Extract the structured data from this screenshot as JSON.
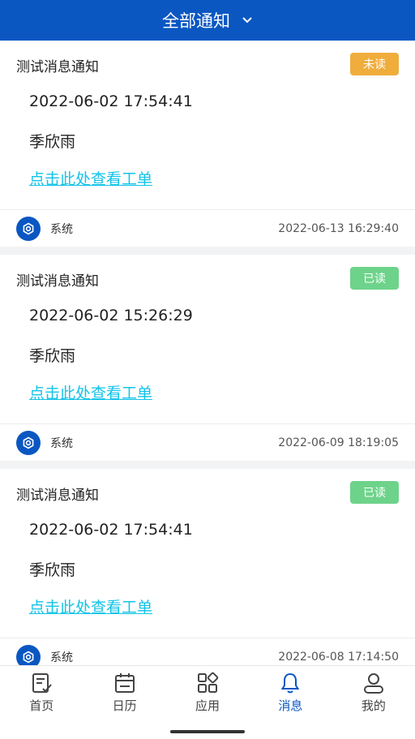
{
  "header": {
    "title": "全部通知"
  },
  "colors": {
    "brand": "#0a57c2",
    "unread": "#f0ad3c",
    "read": "#6dd38a",
    "link": "#12c3e8"
  },
  "notifications": [
    {
      "title": "测试消息通知",
      "status": "未读",
      "status_kind": "unread",
      "date": "2022-06-02 17:54:41",
      "name": "季欣雨",
      "link": "点击此处查看工单",
      "source": "系统",
      "time": "2022-06-13 16:29:40"
    },
    {
      "title": "测试消息通知",
      "status": "已读",
      "status_kind": "read",
      "date": "2022-06-02 15:26:29",
      "name": "季欣雨",
      "link": "点击此处查看工单",
      "source": "系统",
      "time": "2022-06-09 18:19:05"
    },
    {
      "title": "测试消息通知",
      "status": "已读",
      "status_kind": "read",
      "date": "2022-06-02 17:54:41",
      "name": "季欣雨",
      "link": "点击此处查看工单",
      "source": "系统",
      "time": "2022-06-08 17:14:50"
    }
  ],
  "tabbar": [
    {
      "label": "首页",
      "icon": "home-icon",
      "active": false
    },
    {
      "label": "日历",
      "icon": "calendar-icon",
      "active": false
    },
    {
      "label": "应用",
      "icon": "apps-icon",
      "active": false
    },
    {
      "label": "消息",
      "icon": "bell-icon",
      "active": true
    },
    {
      "label": "我的",
      "icon": "profile-icon",
      "active": false
    }
  ]
}
